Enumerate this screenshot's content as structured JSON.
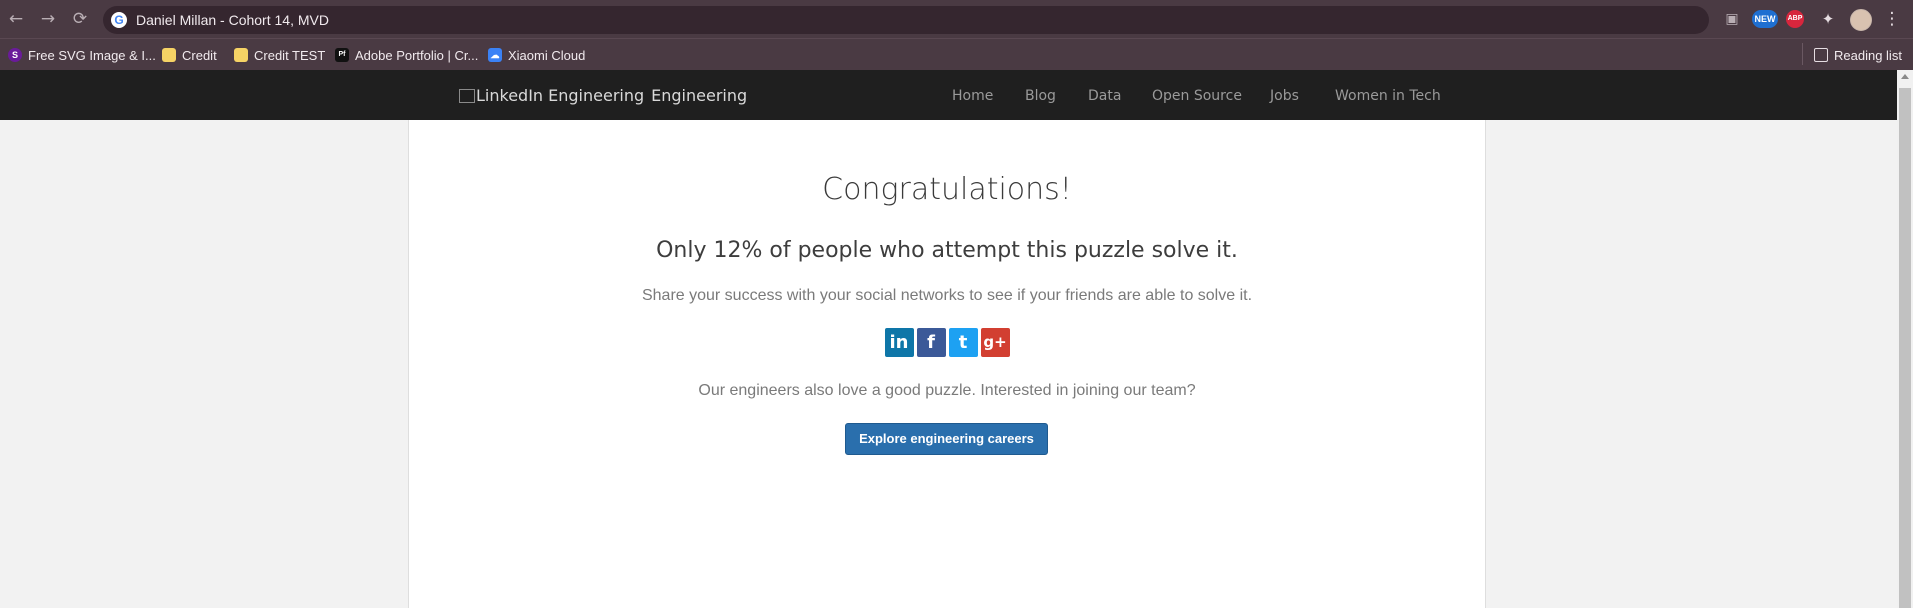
{
  "browser": {
    "url_text": "Daniel Millan - Cohort 14, MVD",
    "ext_new_label": "NEW",
    "ext_abp_label": "ABP",
    "reading_list_label": "Reading list",
    "icons": [
      "back-arrow-icon",
      "forward-arrow-icon",
      "reload-icon",
      "google-icon",
      "cast-icon",
      "puzzle-extension-icon",
      "profile-avatar-icon",
      "menu-dots-icon"
    ]
  },
  "bookmarks": [
    {
      "label": "Free SVG Image & I...",
      "icon_letter": "S",
      "icon_color": "#6a1b9a"
    },
    {
      "label": "Credit",
      "icon_letter": "",
      "icon_color": "#f6d365"
    },
    {
      "label": "Credit TEST",
      "icon_letter": "",
      "icon_color": "#f6d365"
    },
    {
      "label": "Adobe Portfolio | Cr...",
      "icon_letter": "Pf",
      "icon_color": "#111111"
    },
    {
      "label": "Xiaomi Cloud",
      "icon_letter": "☁",
      "icon_color": "#3b82f6"
    }
  ],
  "site": {
    "brand_img_alt": "LinkedIn Engineering",
    "brand_text": "Engineering",
    "nav": [
      "Home",
      "Blog",
      "Data",
      "Open Source",
      "Jobs",
      "Women in Tech"
    ]
  },
  "main": {
    "title": "Congratulations!",
    "subtitle": "Only 12% of people who attempt this puzzle solve it.",
    "share_text": "Share your success with your social networks to see if your friends are able to solve it.",
    "social_labels": [
      "in",
      "f",
      "t",
      "g+"
    ],
    "engineers_text": "Our engineers also love a good puzzle. Interested in joining our team?",
    "cta_label": "Explore engineering careers"
  },
  "colors": {
    "linkedin": "#0e76a8",
    "facebook": "#3b5998",
    "twitter": "#1da1f2",
    "googleplus": "#d23f31",
    "cta": "#2a6fad"
  }
}
